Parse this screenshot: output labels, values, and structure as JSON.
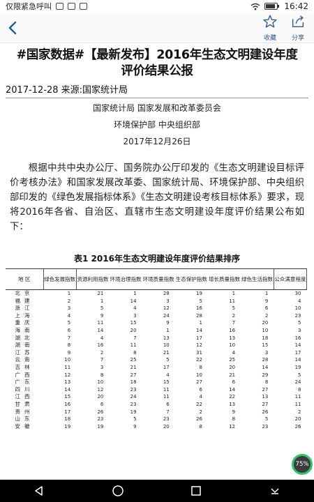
{
  "statusbar": {
    "carrier": "仅限紧急呼叫",
    "time": "16:42"
  },
  "toolbar": {
    "favorite_label": "收藏",
    "share_label": "分享"
  },
  "article": {
    "title_line1": "#国家数据#【最新发布】2016年生态文明建设年度",
    "title_line2": "评价结果公报",
    "meta": "2017-12-28 来源:国家统计局",
    "issuers_line1": "国家统计局  国家发展和改革委员会",
    "issuers_line2": "环境保护部  中央组织部",
    "date": "2017年12月26日",
    "paragraph": "根据中共中央办公厅、国务院办公厅印发的《生态文明建设目标评价考核办法》和国家发展改革委、国家统计局、环境保护部、中央组织部印发的《绿色发展指标体系》《生态文明建设考核目标体系》要求，现将2016年各省、自治区、直辖市生态文明建设年度评价结果公布如下："
  },
  "table": {
    "title": "表1  2016年生态文明建设年度评价结果排序",
    "headers": [
      "地  区",
      "绿色发展指数",
      "资源利用指数",
      "环境治理指数",
      "环境质量指数",
      "生态保护指数",
      "增长质量指数",
      "绿色生活指数",
      "公众满意程度"
    ],
    "rows": [
      [
        "北京",
        "1",
        "21",
        "1",
        "28",
        "19",
        "1",
        "1",
        "30"
      ],
      [
        "福建",
        "2",
        "1",
        "14",
        "3",
        "5",
        "11",
        "9",
        "4"
      ],
      [
        "浙江",
        "3",
        "5",
        "4",
        "12",
        "16",
        "5",
        "6",
        "10"
      ],
      [
        "上海",
        "4",
        "9",
        "3",
        "24",
        "28",
        "2",
        "2",
        "23"
      ],
      [
        "重庆",
        "5",
        "11",
        "15",
        "9",
        "1",
        "7",
        "20",
        "5"
      ],
      [
        "海南",
        "6",
        "14",
        "20",
        "1",
        "14",
        "16",
        "10",
        "3"
      ],
      [
        "湖北",
        "7",
        "4",
        "7",
        "13",
        "17",
        "13",
        "18",
        "16"
      ],
      [
        "湖南",
        "8",
        "16",
        "11",
        "10",
        "12",
        "10",
        "15",
        "14"
      ],
      [
        "江苏",
        "9",
        "2",
        "8",
        "21",
        "31",
        "4",
        "3",
        "17"
      ],
      [
        "云南",
        "10",
        "7",
        "25",
        "5",
        "22",
        "25",
        "28",
        "14"
      ],
      [
        "吉林",
        "11",
        "3",
        "21",
        "17",
        "8",
        "20",
        "14",
        "19"
      ],
      [
        "广西",
        "12",
        "8",
        "27",
        "4",
        "10",
        "21",
        "29",
        "5"
      ],
      [
        "广东",
        "13",
        "10",
        "18",
        "15",
        "27",
        "6",
        "8",
        "24"
      ],
      [
        "四川",
        "14",
        "12",
        "23",
        "11",
        "6",
        "14",
        "27",
        "8"
      ],
      [
        "江西",
        "15",
        "20",
        "24",
        "11",
        "4",
        "22",
        "13",
        "11"
      ],
      [
        "甘肃",
        "16",
        "6",
        "23",
        "6",
        "22",
        "13",
        "27",
        "11"
      ],
      [
        "贵州",
        "17",
        "26",
        "19",
        "7",
        "2",
        "9",
        "26",
        "2"
      ],
      [
        "山东",
        "18",
        "23",
        "5",
        "23",
        "26",
        "8",
        "5",
        "20"
      ],
      [
        "安徽",
        "19",
        "19",
        "9",
        "20",
        "8",
        "12",
        "23",
        "26"
      ]
    ]
  },
  "overlay": {
    "badge": "75%"
  }
}
